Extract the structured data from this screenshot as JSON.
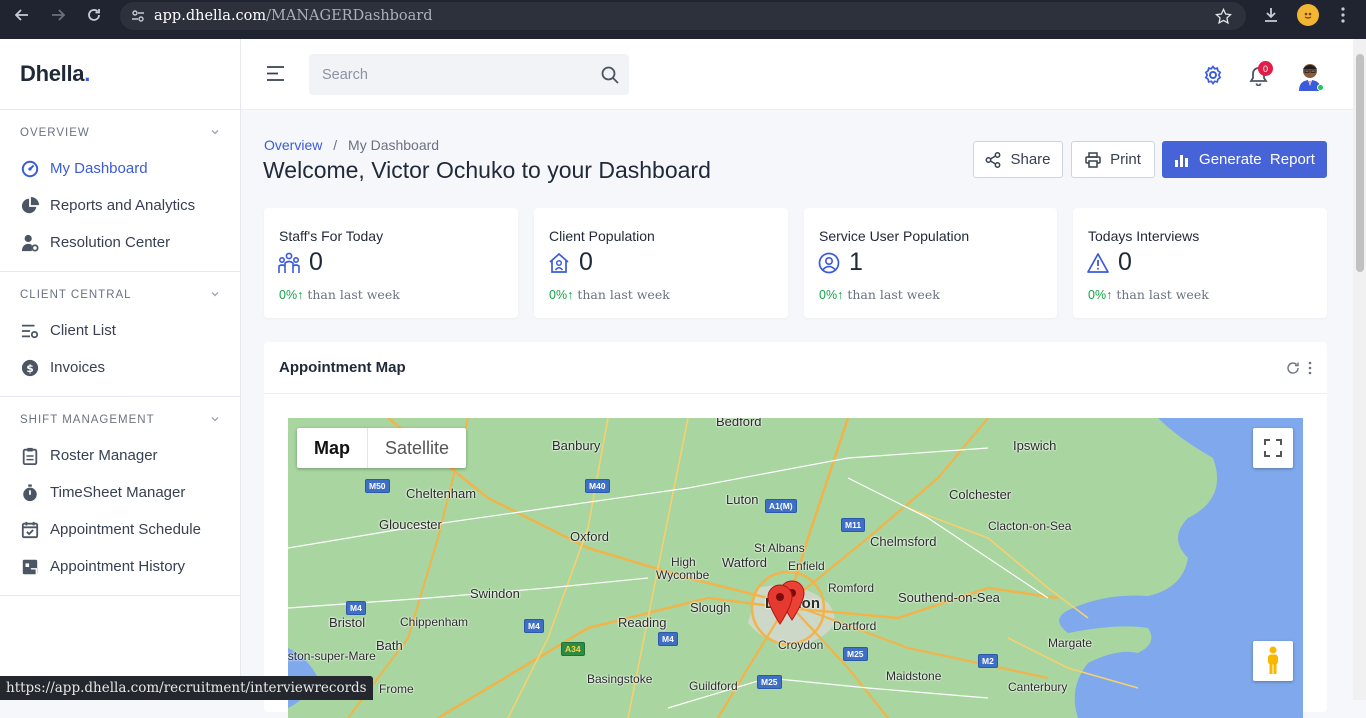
{
  "browser": {
    "url_host": "app.dhella.com",
    "url_path": "/MANAGERDashboard"
  },
  "brand": {
    "name": "Dhella",
    "dot": "."
  },
  "sidebar": {
    "sections": [
      {
        "title": "OVERVIEW",
        "items": [
          {
            "label": "My Dashboard",
            "icon": "gauge-icon",
            "active": true
          },
          {
            "label": "Reports and Analytics",
            "icon": "pie-chart-icon"
          },
          {
            "label": "Resolution Center",
            "icon": "user-gear-icon"
          }
        ]
      },
      {
        "title": "CLIENT CENTRAL",
        "items": [
          {
            "label": "Client List",
            "icon": "list-settings-icon"
          },
          {
            "label": "Invoices",
            "icon": "dollar-circle-icon"
          }
        ]
      },
      {
        "title": "SHIFT MANAGEMENT",
        "items": [
          {
            "label": "Roster Manager",
            "icon": "clipboard-icon"
          },
          {
            "label": "TimeSheet Manager",
            "icon": "stopwatch-icon"
          },
          {
            "label": "Appointment Schedule",
            "icon": "calendar-check-icon"
          },
          {
            "label": "Appointment History",
            "icon": "calendar-history-icon"
          }
        ]
      }
    ]
  },
  "topbar": {
    "search_placeholder": "Search",
    "notification_count": "0"
  },
  "breadcrumb": {
    "root": "Overview",
    "separator": "/",
    "current": "My Dashboard"
  },
  "page_title": "Welcome, Victor Ochuko to your Dashboard",
  "actions": {
    "share": "Share",
    "print": "Print",
    "report": "Generate  Report"
  },
  "stats": [
    {
      "title": "Staff's For Today",
      "value": "0",
      "pct": "0%",
      "footer": "than last week",
      "icon": "people-icon"
    },
    {
      "title": "Client Population",
      "value": "0",
      "pct": "0%",
      "footer": "than last week",
      "icon": "home-user-icon"
    },
    {
      "title": "Service User Population",
      "value": "1",
      "pct": "0%",
      "footer": "than last week",
      "icon": "user-circle-icon"
    },
    {
      "title": "Todays Interviews",
      "value": "0",
      "pct": "0%",
      "footer": "than last week",
      "icon": "warning-triangle-icon"
    }
  ],
  "map": {
    "title": "Appointment Map",
    "type_map": "Map",
    "type_satellite": "Satellite",
    "places": [
      "Bedford",
      "Banbury",
      "Ipswich",
      "Cheltenham",
      "Luton",
      "Colchester",
      "Gloucester",
      "Clacton-on-Sea",
      "Oxford",
      "Chelmsford",
      "St Albans",
      "High",
      "Wycombe",
      "Watford",
      "Enfield",
      "Romford",
      "Swindon",
      "Slough",
      "London",
      "Southend-on-Sea",
      "Dartford",
      "Bristol",
      "Chippenham",
      "Reading",
      "Margate",
      "Bath",
      "Croydon",
      "Weston-super-Mare",
      "Basingstoke",
      "Guildford",
      "Maidstone",
      "Frome",
      "Canterbury"
    ],
    "roads": [
      "M50",
      "M40",
      "A1(M)",
      "M11",
      "M4",
      "M4",
      "M4",
      "M25",
      "A34",
      "M25",
      "M2"
    ]
  },
  "status_url": "https://app.dhella.com/recruitment/interviewrecords",
  "colors": {
    "accent": "#4763d8",
    "positive": "#16a34a",
    "badge": "#e11d48"
  }
}
